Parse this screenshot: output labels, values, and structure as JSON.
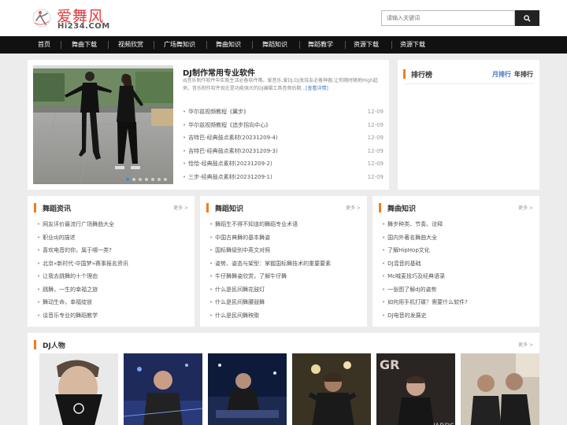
{
  "logo": {
    "cn": "爱舞风",
    "en": "Hi234.COM"
  },
  "search": {
    "placeholder": "请输入关键词"
  },
  "nav": [
    "首页",
    "舞曲下载",
    "视频欣赏",
    "广场舞知识",
    "舞曲知识",
    "舞蹈知识",
    "舞蹈教学",
    "资源下载",
    "资源下载"
  ],
  "feature": {
    "title": "DJ制作常用专业软件",
    "desc": "dj音乐制作软件中实版生活必备软件哦。爱音乐,爱DJ,DJ发烧友必备神器,让你随时随地High起来。音乐制作软件现在是功能强大的DJ编辑工具音频后期...",
    "more": "[查看详情]",
    "items": [
      {
        "title": "华尔兹视频教程《翼步》",
        "date": "12-09"
      },
      {
        "title": "华尔兹视频教程《追步拐向中心》",
        "date": "12-09"
      },
      {
        "title": "吉特巴-经典鼓点素材(20231209-4)",
        "date": "12-09"
      },
      {
        "title": "吉特巴-经典鼓点素材(20231209-3)",
        "date": "12-09"
      },
      {
        "title": "恰恰-经典鼓点素材(20231209-2)",
        "date": "12-09"
      },
      {
        "title": "三步-经典鼓点素材(20231209-1)",
        "date": "12-09"
      }
    ]
  },
  "rank": {
    "title": "排行榜",
    "tab_month": "月排行",
    "tab_year": "年排行"
  },
  "more_label": "更多 >",
  "columns": [
    {
      "title": "舞蹈资讯",
      "items": [
        "网友评价最流行广场舞曲大全",
        "职业dj的描述",
        "喜欢电音的你，属于哪一类?",
        "北京«新时代·中国梦»赛事报名资讯",
        "让我去跳舞的十个理由",
        "跳舞，一生的幸福之旅",
        "舞动生命，幸福绽放",
        "谈音乐专业的舞蹈教学"
      ]
    },
    {
      "title": "舞蹈知识",
      "items": [
        "舞蹈生不得不知道的舞蹈专业术语",
        "中国古典舞的基本舞姿",
        "国标舞级别中英文对照",
        "姿势、姿态与架型：掌握国标舞技术的重要要素",
        "牛仔舞舞姿欣赏，了解牛仔舞",
        "什么是民间舞花鼓灯",
        "什么是民间舞腰鼓舞",
        "什么是民间舞秧歌"
      ]
    },
    {
      "title": "舞曲知识",
      "items": [
        "舞步种类、节奏、诠释",
        "国内外著名舞曲大全",
        "了解HipHop文化",
        "DJ混音的基础",
        "Mc喊麦技巧及经典语录",
        "一张图了解dj的姿势",
        "如何用手机打碟？需要什么软件?",
        "DJ电音的发展史"
      ]
    }
  ],
  "people": {
    "title": "DJ人物"
  },
  "colors": {
    "accent": "#f07d1d",
    "brand_red": "#e0393e",
    "link_blue": "#3a76c8",
    "dot_active": "#3d8be0",
    "nav_bg": "#111111"
  }
}
